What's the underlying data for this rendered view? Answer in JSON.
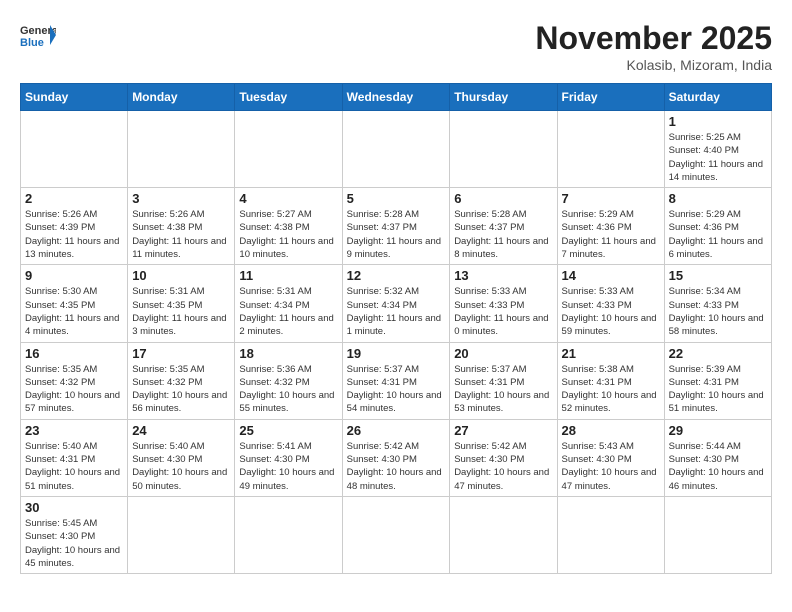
{
  "header": {
    "logo_general": "General",
    "logo_blue": "Blue",
    "month_year": "November 2025",
    "location": "Kolasib, Mizoram, India"
  },
  "days_of_week": [
    "Sunday",
    "Monday",
    "Tuesday",
    "Wednesday",
    "Thursday",
    "Friday",
    "Saturday"
  ],
  "weeks": [
    [
      {
        "day": "",
        "info": ""
      },
      {
        "day": "",
        "info": ""
      },
      {
        "day": "",
        "info": ""
      },
      {
        "day": "",
        "info": ""
      },
      {
        "day": "",
        "info": ""
      },
      {
        "day": "",
        "info": ""
      },
      {
        "day": "1",
        "info": "Sunrise: 5:25 AM\nSunset: 4:40 PM\nDaylight: 11 hours and 14 minutes."
      }
    ],
    [
      {
        "day": "2",
        "info": "Sunrise: 5:26 AM\nSunset: 4:39 PM\nDaylight: 11 hours and 13 minutes."
      },
      {
        "day": "3",
        "info": "Sunrise: 5:26 AM\nSunset: 4:38 PM\nDaylight: 11 hours and 11 minutes."
      },
      {
        "day": "4",
        "info": "Sunrise: 5:27 AM\nSunset: 4:38 PM\nDaylight: 11 hours and 10 minutes."
      },
      {
        "day": "5",
        "info": "Sunrise: 5:28 AM\nSunset: 4:37 PM\nDaylight: 11 hours and 9 minutes."
      },
      {
        "day": "6",
        "info": "Sunrise: 5:28 AM\nSunset: 4:37 PM\nDaylight: 11 hours and 8 minutes."
      },
      {
        "day": "7",
        "info": "Sunrise: 5:29 AM\nSunset: 4:36 PM\nDaylight: 11 hours and 7 minutes."
      },
      {
        "day": "8",
        "info": "Sunrise: 5:29 AM\nSunset: 4:36 PM\nDaylight: 11 hours and 6 minutes."
      }
    ],
    [
      {
        "day": "9",
        "info": "Sunrise: 5:30 AM\nSunset: 4:35 PM\nDaylight: 11 hours and 4 minutes."
      },
      {
        "day": "10",
        "info": "Sunrise: 5:31 AM\nSunset: 4:35 PM\nDaylight: 11 hours and 3 minutes."
      },
      {
        "day": "11",
        "info": "Sunrise: 5:31 AM\nSunset: 4:34 PM\nDaylight: 11 hours and 2 minutes."
      },
      {
        "day": "12",
        "info": "Sunrise: 5:32 AM\nSunset: 4:34 PM\nDaylight: 11 hours and 1 minute."
      },
      {
        "day": "13",
        "info": "Sunrise: 5:33 AM\nSunset: 4:33 PM\nDaylight: 11 hours and 0 minutes."
      },
      {
        "day": "14",
        "info": "Sunrise: 5:33 AM\nSunset: 4:33 PM\nDaylight: 10 hours and 59 minutes."
      },
      {
        "day": "15",
        "info": "Sunrise: 5:34 AM\nSunset: 4:33 PM\nDaylight: 10 hours and 58 minutes."
      }
    ],
    [
      {
        "day": "16",
        "info": "Sunrise: 5:35 AM\nSunset: 4:32 PM\nDaylight: 10 hours and 57 minutes."
      },
      {
        "day": "17",
        "info": "Sunrise: 5:35 AM\nSunset: 4:32 PM\nDaylight: 10 hours and 56 minutes."
      },
      {
        "day": "18",
        "info": "Sunrise: 5:36 AM\nSunset: 4:32 PM\nDaylight: 10 hours and 55 minutes."
      },
      {
        "day": "19",
        "info": "Sunrise: 5:37 AM\nSunset: 4:31 PM\nDaylight: 10 hours and 54 minutes."
      },
      {
        "day": "20",
        "info": "Sunrise: 5:37 AM\nSunset: 4:31 PM\nDaylight: 10 hours and 53 minutes."
      },
      {
        "day": "21",
        "info": "Sunrise: 5:38 AM\nSunset: 4:31 PM\nDaylight: 10 hours and 52 minutes."
      },
      {
        "day": "22",
        "info": "Sunrise: 5:39 AM\nSunset: 4:31 PM\nDaylight: 10 hours and 51 minutes."
      }
    ],
    [
      {
        "day": "23",
        "info": "Sunrise: 5:40 AM\nSunset: 4:31 PM\nDaylight: 10 hours and 51 minutes."
      },
      {
        "day": "24",
        "info": "Sunrise: 5:40 AM\nSunset: 4:30 PM\nDaylight: 10 hours and 50 minutes."
      },
      {
        "day": "25",
        "info": "Sunrise: 5:41 AM\nSunset: 4:30 PM\nDaylight: 10 hours and 49 minutes."
      },
      {
        "day": "26",
        "info": "Sunrise: 5:42 AM\nSunset: 4:30 PM\nDaylight: 10 hours and 48 minutes."
      },
      {
        "day": "27",
        "info": "Sunrise: 5:42 AM\nSunset: 4:30 PM\nDaylight: 10 hours and 47 minutes."
      },
      {
        "day": "28",
        "info": "Sunrise: 5:43 AM\nSunset: 4:30 PM\nDaylight: 10 hours and 47 minutes."
      },
      {
        "day": "29",
        "info": "Sunrise: 5:44 AM\nSunset: 4:30 PM\nDaylight: 10 hours and 46 minutes."
      }
    ],
    [
      {
        "day": "30",
        "info": "Sunrise: 5:45 AM\nSunset: 4:30 PM\nDaylight: 10 hours and 45 minutes."
      },
      {
        "day": "",
        "info": ""
      },
      {
        "day": "",
        "info": ""
      },
      {
        "day": "",
        "info": ""
      },
      {
        "day": "",
        "info": ""
      },
      {
        "day": "",
        "info": ""
      },
      {
        "day": "",
        "info": ""
      }
    ]
  ]
}
